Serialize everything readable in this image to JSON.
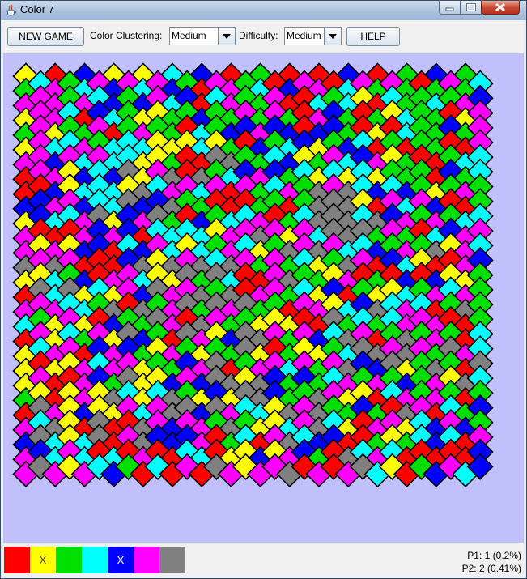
{
  "window": {
    "title": "Color 7"
  },
  "toolbar": {
    "new_game_label": "NEW GAME",
    "clustering_label": "Color Clustering:",
    "clustering_value": "Medium",
    "difficulty_label": "Difficulty:",
    "difficulty_value": "Medium",
    "help_label": "HELP"
  },
  "palette": [
    {
      "name": "red",
      "color": "#ff0000",
      "mark": ""
    },
    {
      "name": "yellow",
      "color": "#ffff00",
      "mark": "X"
    },
    {
      "name": "green",
      "color": "#00e000",
      "mark": ""
    },
    {
      "name": "cyan",
      "color": "#00ffff",
      "mark": ""
    },
    {
      "name": "blue",
      "color": "#0000ff",
      "mark": "X"
    },
    {
      "name": "magenta",
      "color": "#ff00ff",
      "mark": ""
    },
    {
      "name": "gray",
      "color": "#808080",
      "mark": ""
    }
  ],
  "scores": {
    "p1": "P1: 1 (0.2%)",
    "p2": "P2: 2 (0.41%)"
  },
  "board": {
    "background": "#c0c0fc",
    "rows": [
      "YRBYYCBRGRRBRGBG",
      "GCMGCMBMCMBGRMMGCRBMMRCMGMGRGMGC",
      "MMMGMCBGBMCBRCMGGMRRCGCYRCGGCGMB",
      "YMMCRBCGYYGGBGGMGMGRMBGRGYCGGRYM",
      "GMYGGMRGMGGRCGBBMBBRBBGRYRCGGBGM",
      "YMCCMGCCCYYYCYGRBGCBYGBCRGRGGRRM",
      "MMBMCMCCYYGRRXXGGCBYGMCBMYGRRGCC",
      "RMMYBCBXYMXRXGCBMBGCYCYCYGGGRBGC",
      "RRBYCCCYXCMMCMRMGCMGXMXCBCBGYGMG",
      "BBMMBCCXBBXGGRRRGGRGXXXYRMCMBRRG",
      "YBCCMXYBMXGRBGCCMRGCXXXCXBMGMGCC",
      "MRRRMBMBRCCCCYMMXMYMCXXXGMGRCBMM",
      "MYMYBBRCBMCYCGMCYGXMXMCCBGMGXYMC",
      "XMXMRRRBXYXMXCXMGMGCYGXMRBCYRRMB",
      "YYCGBRMMCYYXGXCRRMXGGYMRGRBRBYYG",
      "RXCXYCYMBXMMXGXRMMGCYBRGYYCGMCMG",
      "MMMCCGXRXGMXGXMXGGRMMYCBXCMCRGXG",
      "CGYMYRBGGXMRXMGGYYYRRXGCGCMMMRRG",
      "RMYCGMYXBGRXMYBXXMGMBCXMRGXGMGRC",
      "YCMMRBMBGYMGYGGXYRGYYGCXXMXMGXMC",
      "YRYYMCMMYGGBMXRGMMCMGMXBBXYGXGRX",
      "YMRRMBGXYYBMBXXYXBGBGCMGMGBGMYXC",
      "GYRYMYXCYCXGYBYXXBGGXMYYRCMGMGRG",
      "RXMYBYYMCMXXBXMCCYXMXGGBGRXMRCGB",
      "MCXYRXRRXMBMMGXGYYCMXCYRMMYCBMBG",
      "BXCYCXRMXBBBMRGCRMXCBBRRGYGCBCRM",
      "MBCMCRCRMRRCCRYYBYMBGRXCMCRRRRRB",
      "MXMYMCBGRCRMRXMYMMXRMRMXCYRGBMCB"
    ]
  }
}
